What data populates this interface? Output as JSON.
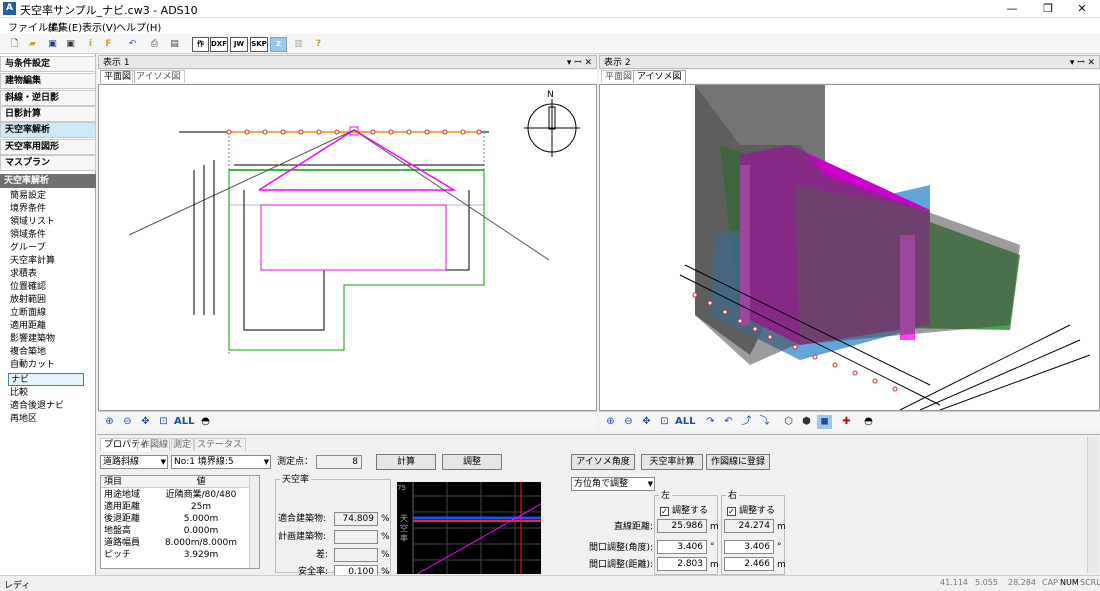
{
  "window": {
    "title": "天空率サンプル_ナビ.cw3 - ADS10",
    "icon_letter": "A",
    "minimize": "—",
    "maximize": "❐",
    "close": "✕"
  },
  "menu": [
    "ファイル(F)",
    "編集(E)",
    "表示(V)",
    "ヘルプ(H)"
  ],
  "toolbar": {
    "text_buttons": [
      "作",
      "DXF",
      "JW",
      "SKP",
      "Z"
    ]
  },
  "sidebar": {
    "nav": [
      "与条件設定",
      "建物編集",
      "斜線・逆日影",
      "日影計算",
      "天空率解析",
      "天空率用図形",
      "マスプラン"
    ],
    "section": "天空率解析",
    "items": [
      "簡易設定",
      "境界条件",
      "領域リスト",
      "領域条件",
      "グループ",
      "天空率計算",
      "求積表",
      "位置確認",
      "放射範囲",
      "立断面線",
      "適用距離",
      "影響建築物",
      "複合築地",
      "自動カット",
      "ナビ",
      "比較",
      "適合後退ナビ",
      "再地区"
    ]
  },
  "view1": {
    "title": "表示 1",
    "controls": "▾ ꟷ ✕",
    "tabs": [
      "平面図",
      "アイソメ図"
    ],
    "compass": "N",
    "all_label": "ALL"
  },
  "view2": {
    "title": "表示 2",
    "controls": "▾ ꟷ ✕",
    "tabs": [
      "平面図",
      "アイソメ図"
    ],
    "all_label": "ALL"
  },
  "bottom": {
    "tabs": [
      "プロパティ",
      "作図線",
      "測定",
      "ステータス"
    ],
    "dropdown1": "道路斜線",
    "dropdown2": "No:1 境界線:5",
    "measure_label": "測定点：",
    "measure_value": "8",
    "calc_button": "計算",
    "adjust_button": "調整",
    "table": {
      "headers": [
        "項目",
        "値"
      ],
      "rows": [
        [
          "用途地域",
          "近隣商業/80/480"
        ],
        [
          "適用距離",
          "25m"
        ],
        [
          "後退距離",
          "5.000m"
        ],
        [
          "地盤高",
          "0.000m"
        ],
        [
          "道路幅員",
          "8.000m/8.000m"
        ],
        [
          "ピッチ",
          "3.929m"
        ]
      ]
    },
    "sky": {
      "group": "天空率",
      "rows": [
        {
          "label": "適合建築物:",
          "value": "74.809",
          "unit": "%"
        },
        {
          "label": "計画建築物:",
          "value": "",
          "unit": "%"
        },
        {
          "label": "差:",
          "value": "",
          "unit": "%"
        },
        {
          "label": "安全率:",
          "value": "0.100",
          "unit": "%"
        }
      ]
    },
    "graph": {
      "top_label": "75",
      "side_text": "天空率"
    },
    "right": {
      "iso_button": "アイソメ角度",
      "sky_calc_button": "天空率計算",
      "register_button": "作図線に登録",
      "method": "方位角で調整",
      "left_group": "左",
      "right_group": "右",
      "adjust_label": "調整する",
      "line_distance_label": "直線距離:",
      "angle_label": "間口調整(角度):",
      "distance_label": "間口調整(距離):",
      "left": {
        "line": "25.986",
        "angle": "3.406",
        "dist": "2.803"
      },
      "right": {
        "line": "24.274",
        "angle": "3.406",
        "dist": "2.466"
      },
      "unit_m": "m",
      "unit_deg": "°"
    }
  },
  "status": {
    "left": "レディ",
    "coords": [
      "41.114",
      "5.055",
      "28.284"
    ],
    "flags": [
      "CAP",
      "NUM",
      "SCRL"
    ]
  },
  "colors": {
    "accent": "#cde8f6",
    "magenta": "#ff00ff",
    "green": "#00a000"
  }
}
